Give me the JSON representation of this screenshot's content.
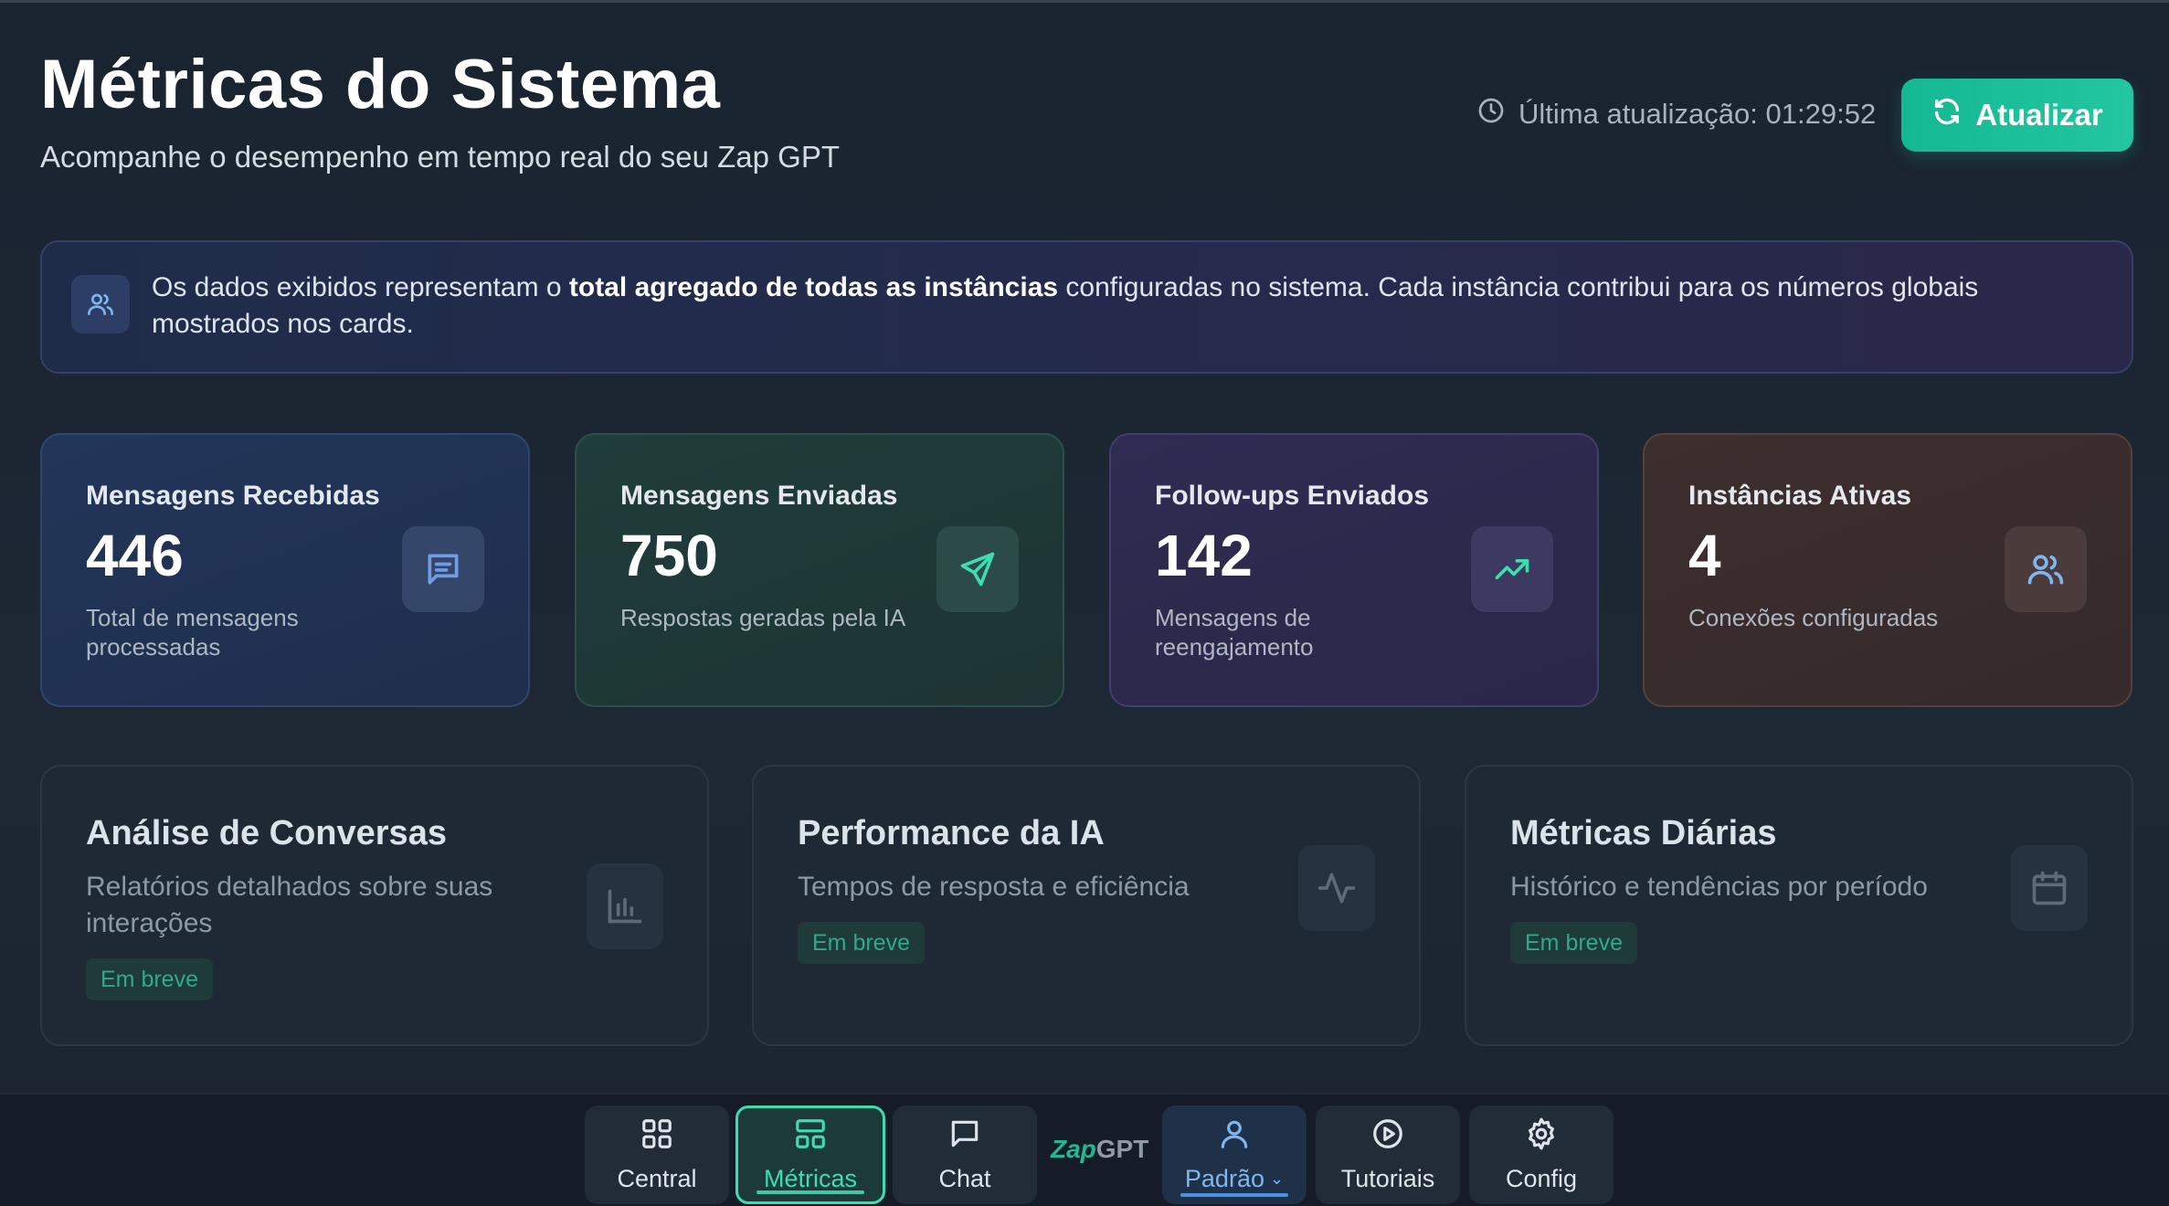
{
  "header": {
    "title": "Métricas do Sistema",
    "subtitle": "Acompanhe o desempenho em tempo real do seu Zap GPT",
    "last_update": "Última atualização: 01:29:52",
    "refresh_label": "Atualizar"
  },
  "info": {
    "text_before": "Os dados exibidos representam o ",
    "text_bold": "total agregado de todas as instâncias",
    "text_after": " configuradas no sistema. Cada instância contribui para os números globais mostrados nos cards."
  },
  "stats": [
    {
      "label": "Mensagens Recebidas",
      "value": "446",
      "desc": "Total de mensagens processadas",
      "icon": "message-square-icon",
      "color": "#6f9ee8"
    },
    {
      "label": "Mensagens Enviadas",
      "value": "750",
      "desc": "Respostas geradas pela IA",
      "icon": "send-icon",
      "color": "#3fdcb0"
    },
    {
      "label": "Follow-ups Enviados",
      "value": "142",
      "desc": "Mensagens de reengajamento",
      "icon": "trending-up-icon",
      "color": "#3fdcb0"
    },
    {
      "label": "Instâncias Ativas",
      "value": "4",
      "desc": "Conexões configuradas",
      "icon": "users-icon",
      "color": "#7fb6f0"
    }
  ],
  "features": [
    {
      "title": "Análise de Conversas",
      "desc": "Relatórios detalhados sobre suas interações",
      "badge": "Em breve",
      "icon": "bar-chart-icon"
    },
    {
      "title": "Performance da IA",
      "desc": "Tempos de resposta e eficiência",
      "badge": "Em breve",
      "icon": "activity-icon"
    },
    {
      "title": "Métricas Diárias",
      "desc": "Histórico e tendências por período",
      "badge": "Em breve",
      "icon": "calendar-icon"
    }
  ],
  "nav": {
    "items": [
      {
        "label": "Central",
        "icon": "grid-icon"
      },
      {
        "label": "Métricas",
        "icon": "layout-icon"
      },
      {
        "label": "Chat",
        "icon": "chat-icon"
      },
      {
        "label": "Padrão",
        "icon": "user-icon"
      },
      {
        "label": "Tutoriais",
        "icon": "play-circle-icon"
      },
      {
        "label": "Config",
        "icon": "gear-icon"
      }
    ],
    "logo_main": "Zap",
    "logo_suffix": "GPT",
    "accent": "#3fdcb0"
  }
}
